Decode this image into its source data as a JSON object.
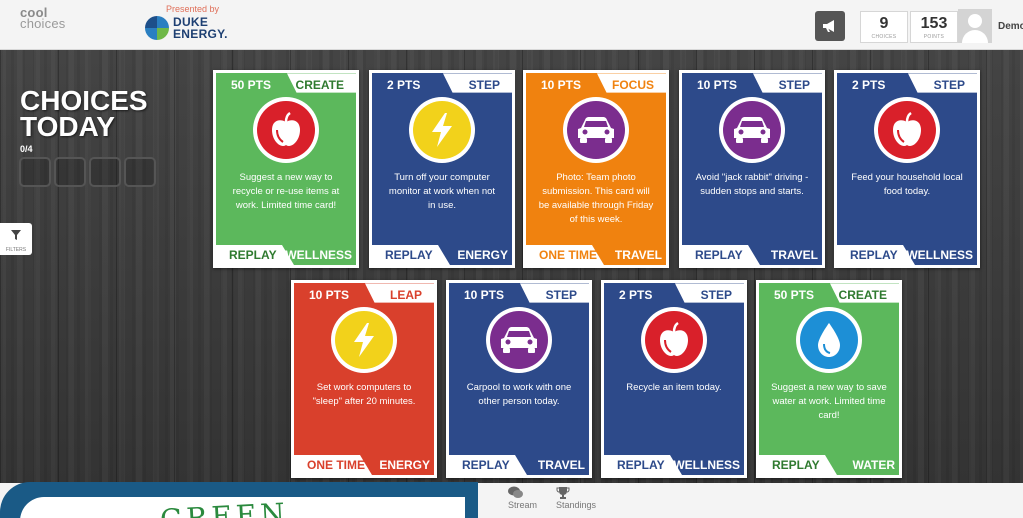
{
  "header": {
    "logo_line1": "cool",
    "logo_line2": "choices",
    "presented_by": "Presented by",
    "sponsor_line1": "DUKE",
    "sponsor_line2": "ENERGY.",
    "choices_count": "9",
    "choices_label": "CHOICES",
    "points_count": "153",
    "points_label": "POINTS",
    "username": "Demo"
  },
  "sidebar": {
    "title_line1": "CHOICES",
    "title_line2": "TODAY",
    "progress": "0/4",
    "filters_label": "FILTERS"
  },
  "cards": [
    {
      "pts": "50 PTS",
      "type": "CREATE",
      "color": "green",
      "icon": "apple-icon",
      "desc": "Suggest a new way to recycle or re-use items at work. Limited time card!",
      "mode": "REPLAY",
      "category": "WELLNESS"
    },
    {
      "pts": "2 PTS",
      "type": "STEP",
      "color": "navy",
      "icon": "lightning-icon",
      "desc": "Turn off your computer monitor at work when not in use.",
      "mode": "REPLAY",
      "category": "ENERGY"
    },
    {
      "pts": "10 PTS",
      "type": "FOCUS",
      "color": "orange",
      "icon": "car-icon",
      "desc": "Photo: Team photo submission. This card will be available through Friday of this week.",
      "mode": "ONE TIME",
      "category": "TRAVEL"
    },
    {
      "pts": "10 PTS",
      "type": "STEP",
      "color": "navy",
      "icon": "car-icon",
      "desc": "Avoid \"jack rabbit\" driving - sudden stops and starts.",
      "mode": "REPLAY",
      "category": "TRAVEL"
    },
    {
      "pts": "2 PTS",
      "type": "STEP",
      "color": "navy",
      "icon": "apple-icon",
      "desc": "Feed your household local food today.",
      "mode": "REPLAY",
      "category": "WELLNESS"
    },
    {
      "pts": "10 PTS",
      "type": "LEAP",
      "color": "red",
      "icon": "lightning-icon",
      "desc": "Set work computers to \"sleep\" after 20 minutes.",
      "mode": "ONE TIME",
      "category": "ENERGY"
    },
    {
      "pts": "10 PTS",
      "type": "STEP",
      "color": "navy",
      "icon": "car-icon",
      "desc": "Carpool to work with one other person today.",
      "mode": "REPLAY",
      "category": "TRAVEL"
    },
    {
      "pts": "2 PTS",
      "type": "STEP",
      "color": "navy",
      "icon": "apple-icon",
      "desc": "Recycle an item today.",
      "mode": "REPLAY",
      "category": "WELLNESS"
    },
    {
      "pts": "50 PTS",
      "type": "CREATE",
      "color": "green",
      "icon": "water-drop-icon",
      "desc": "Suggest a new way to save water at work. Limited time card!",
      "mode": "REPLAY",
      "category": "WATER"
    }
  ],
  "bottom": {
    "stream_label": "Stream",
    "standings_label": "Standings",
    "overlay_text": "GREEN"
  },
  "colors": {
    "green": "#5cb85c",
    "navy": "#2d4a8a",
    "orange": "#f0820f",
    "red": "#d9402c",
    "apple_red": "#d9202a",
    "lightning_yellow": "#f2d21b",
    "car_purple": "#7b2d8e",
    "water_blue": "#1d8fd6"
  }
}
